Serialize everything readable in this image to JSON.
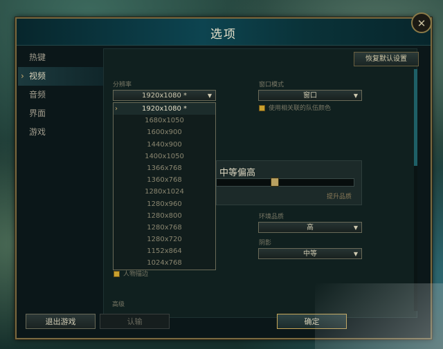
{
  "window": {
    "title": "选项",
    "close_symbol": "✕"
  },
  "sidebar": {
    "items": [
      {
        "label": "热键",
        "active": false
      },
      {
        "label": "视频",
        "active": true
      },
      {
        "label": "音频",
        "active": false
      },
      {
        "label": "界面",
        "active": false
      },
      {
        "label": "游戏",
        "active": false
      }
    ]
  },
  "toolbar": {
    "reset_label": "恢复默认设置"
  },
  "resolution": {
    "label": "分辨率",
    "selected": "1920x1080 *",
    "options": [
      "1920x1080 *",
      "1680x1050",
      "1600x900",
      "1440x900",
      "1400x1050",
      "1366x768",
      "1360x768",
      "1280x1024",
      "1280x960",
      "1280x800",
      "1280x768",
      "1280x720",
      "1152x864",
      "1024x768"
    ]
  },
  "window_mode": {
    "label": "窗口模式",
    "selected": "窗口",
    "checkbox_label": "使用相关联的队伍颜色"
  },
  "graphics": {
    "quality_title": "中等偏高",
    "slider_value": 0.42,
    "enhance_label": "提升品质"
  },
  "environment": {
    "label": "环境品质",
    "selected": "高"
  },
  "shadow": {
    "label": "阴影",
    "selected": "中等"
  },
  "partial_checkbox_label": "人物描边",
  "section_label": "高级",
  "footer": {
    "exit_label": "退出游戏",
    "surrender_label": "认输",
    "confirm_label": "确定"
  },
  "colors": {
    "accent_gold": "#c8aa6e",
    "panel": "#10201f",
    "highlight_teal": "#0d4450"
  }
}
